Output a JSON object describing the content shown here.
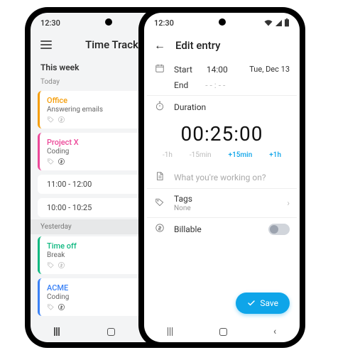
{
  "left": {
    "status_time": "12:30",
    "app_title": "Time Track",
    "section": "This week",
    "today_label": "Today",
    "yesterday_label": "Yesterday",
    "entries_today": [
      {
        "project": "Office",
        "task": "Answering emails",
        "color": "orange"
      },
      {
        "project": "Project X",
        "task": "Coding",
        "color": "pink"
      }
    ],
    "time_slots": [
      "11:00 - 12:00",
      "10:00 - 10:25"
    ],
    "entries_yesterday": [
      {
        "project": "Time off",
        "task": "Break",
        "color": "teal"
      },
      {
        "project": "ACME",
        "task": "Coding",
        "color": "blue"
      }
    ]
  },
  "right": {
    "status_time": "12:30",
    "app_title": "Edit entry",
    "start_label": "Start",
    "start_time": "14:00",
    "start_date": "Tue, Dec 13",
    "end_label": "End",
    "end_time": "- - : - -",
    "duration_label": "Duration",
    "duration_value": "00:25:00",
    "quick": [
      "-1h",
      "-15min",
      "+15min",
      "+1h"
    ],
    "desc_placeholder": "What you're working on?",
    "tags_label": "Tags",
    "tags_value": "None",
    "billable_label": "Billable",
    "save_label": "Save"
  }
}
